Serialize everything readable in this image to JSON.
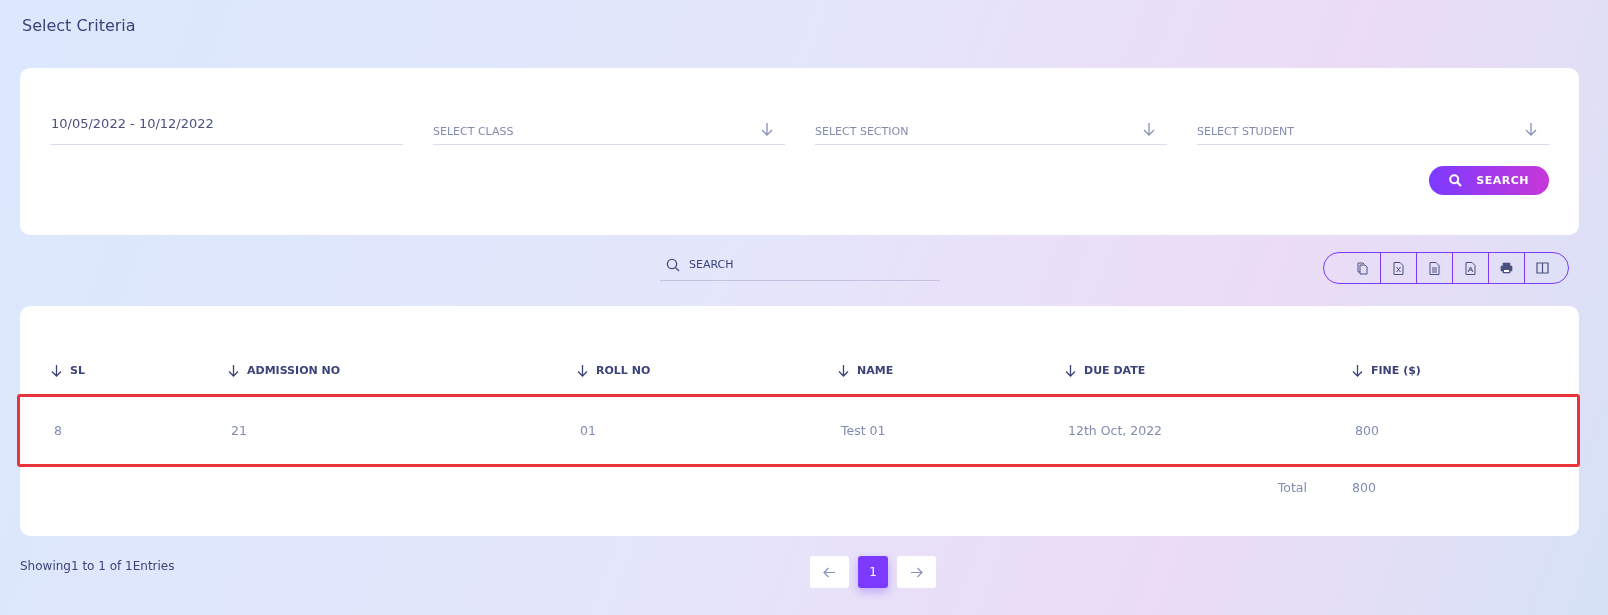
{
  "title": "Select Criteria",
  "filters": [
    {
      "kind": "date",
      "value": "10/05/2022 - 10/12/2022"
    },
    {
      "kind": "select",
      "placeholder": "SELECT CLASS"
    },
    {
      "kind": "select",
      "placeholder": "SELECT SECTION"
    },
    {
      "kind": "select",
      "placeholder": "SELECT STUDENT"
    }
  ],
  "search_button": "SEARCH",
  "table_search": {
    "placeholder": "SEARCH"
  },
  "export_buttons": [
    {
      "kind": "copy"
    },
    {
      "kind": "excel"
    },
    {
      "kind": "csv"
    },
    {
      "kind": "pdf"
    },
    {
      "kind": "print"
    },
    {
      "kind": "columns"
    }
  ],
  "table": {
    "columns": [
      "SL",
      "ADMISSION NO",
      "ROLL NO",
      "NAME",
      "DUE DATE",
      "FINE ($)"
    ],
    "rows": [
      {
        "cells": [
          "8",
          "21",
          "01",
          "Test 01",
          "12th Oct, 2022",
          "800"
        ],
        "highlighted": true
      }
    ],
    "total": {
      "label": "Total",
      "value": "800"
    }
  },
  "footer": {
    "info": "Showing1 to 1 of 1Entries"
  },
  "pagination": {
    "pages": [
      {
        "label": "1",
        "selected": true
      }
    ]
  }
}
